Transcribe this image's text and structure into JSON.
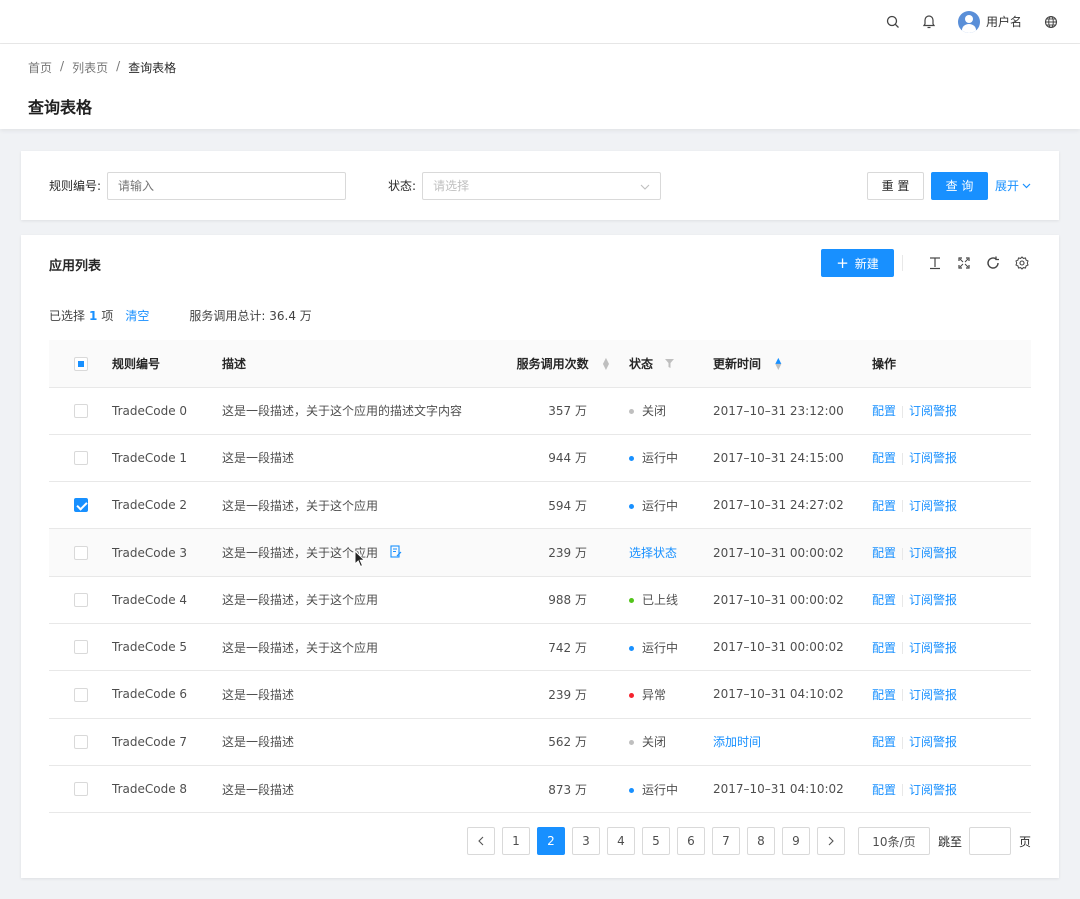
{
  "header": {
    "username": "用户名"
  },
  "breadcrumb": [
    "首页",
    "/",
    "列表页",
    "/",
    "查询表格"
  ],
  "page_title": "查询表格",
  "search": {
    "rule_label": "规则编号:",
    "rule_placeholder": "请输入",
    "status_label": "状态:",
    "status_placeholder": "请选择",
    "reset_label": "重 置",
    "query_label": "查 询",
    "expand_label": "展开"
  },
  "table_card": {
    "title": "应用列表",
    "new_label": "新建",
    "selected_prefix": "已选择",
    "selected_count": "1",
    "selected_suffix": "项",
    "clear_label": "清空",
    "total_text": "服务调用总计: 36.4 万"
  },
  "columns": [
    "规则编号",
    "描述",
    "服务调用次数",
    "状态",
    "更新时间",
    "操作"
  ],
  "rows": [
    {
      "code": "TradeCode 0",
      "desc": "这是一段描述，关于这个应用的描述文字内容",
      "calls": "357 万",
      "status": "关闭",
      "status_color": "#bfbfbf",
      "time": "2017–10–31  23:12:00",
      "op1": "配置",
      "op2": "订阅警报",
      "checked": false
    },
    {
      "code": "TradeCode 1",
      "desc": "这是一段描述",
      "calls": "944 万",
      "status": "运行中",
      "status_color": "#1890ff",
      "time": "2017–10–31  24:15:00",
      "op1": "配置",
      "op2": "订阅警报",
      "checked": false
    },
    {
      "code": "TradeCode 2",
      "desc": "这是一段描述，关于这个应用",
      "calls": "594 万",
      "status": "运行中",
      "status_color": "#1890ff",
      "time": "2017–10–31  24:27:02",
      "op1": "配置",
      "op2": "订阅警报",
      "checked": true
    },
    {
      "code": "TradeCode 3",
      "desc": "这是一段描述，关于这个应用",
      "calls": "239 万",
      "status": "选择状态",
      "status_color": "",
      "time": "2017–10–31  00:00:02",
      "op1": "配置",
      "op2": "订阅警报",
      "checked": false
    },
    {
      "code": "TradeCode 4",
      "desc": "这是一段描述，关于这个应用",
      "calls": "988 万",
      "status": "已上线",
      "status_color": "#52c41a",
      "time": "2017–10–31  00:00:02",
      "op1": "配置",
      "op2": "订阅警报",
      "checked": false
    },
    {
      "code": "TradeCode 5",
      "desc": "这是一段描述，关于这个应用",
      "calls": "742 万",
      "status": "运行中",
      "status_color": "#1890ff",
      "time": "2017–10–31  00:00:02",
      "op1": "配置",
      "op2": "订阅警报",
      "checked": false
    },
    {
      "code": "TradeCode 6",
      "desc": "这是一段描述",
      "calls": "239 万",
      "status": "异常",
      "status_color": "#f5222d",
      "time": "2017–10–31  04:10:02",
      "op1": "配置",
      "op2": "订阅警报",
      "checked": false
    },
    {
      "code": "TradeCode 7",
      "desc": "这是一段描述",
      "calls": "562 万",
      "status": "关闭",
      "status_color": "#bfbfbf",
      "time": "添加时间",
      "op1": "配置",
      "op2": "订阅警报",
      "checked": false
    },
    {
      "code": "TradeCode 8",
      "desc": "这是一段描述",
      "calls": "873 万",
      "status": "运行中",
      "status_color": "#1890ff",
      "time": "2017–10–31  04:10:02",
      "op1": "配置",
      "op2": "订阅警报",
      "checked": false
    }
  ],
  "pagination": {
    "prev": "<",
    "next": ">",
    "pages": [
      "1",
      "2",
      "3",
      "4",
      "5",
      "6",
      "7",
      "8",
      "9"
    ],
    "current": "2",
    "page_size": "10条/页",
    "jump_label": "跳至",
    "page_suffix": "页"
  },
  "colors": {
    "primary": "#1890ff"
  },
  "icons": [
    "search-icon",
    "bell-icon",
    "avatar",
    "globe-icon",
    "plus-icon",
    "density-icon",
    "fullscreen-icon",
    "reload-icon",
    "settings-icon",
    "chevron-down-icon",
    "edit-icon",
    "sort-icon",
    "filter-icon",
    "cursor-icon"
  ]
}
